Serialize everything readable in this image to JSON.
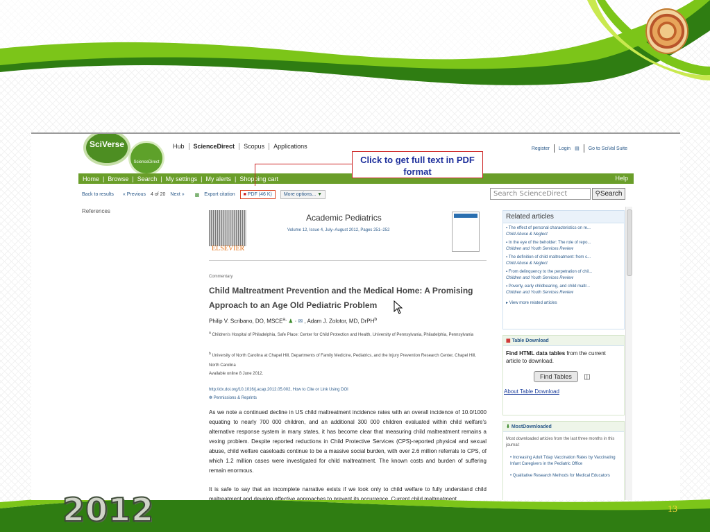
{
  "slide": {
    "page_number": "13",
    "year": "2012"
  },
  "colors": {
    "slide_green": "#7cc519",
    "slide_dark_green": "#2f7d12",
    "brand_green": "#6a9e2a",
    "callout_red": "#cc2222",
    "link_blue": "#2b5a8a"
  },
  "browser": {
    "logo_main": "SciVerse",
    "logo_sub": "ScienceDirect",
    "topnav": [
      "Hub",
      "ScienceDirect",
      "Scopus",
      "Applications"
    ],
    "topright": [
      "Register",
      "Login",
      "Go to SciVal Suite"
    ],
    "callout": "Click to get full text in PDF format",
    "greenbar": [
      "Home",
      "Browse",
      "Search",
      "My settings",
      "My alerts",
      "Shopping cart"
    ],
    "help": "Help",
    "toolrow": {
      "back": "Back to results",
      "previous": "« Previous",
      "position": "4 of 20",
      "next": "Next »",
      "export": "Export citation",
      "pdf": "PDF (46 K)",
      "more": "More options..."
    },
    "search": {
      "placeholder": "Search ScienceDirect",
      "button": "Search"
    },
    "left_label": "References",
    "article": {
      "publisher": "ELSEVIER",
      "journal": "Academic Pediatrics",
      "volume": "Volume 12, Issue 4, July–August 2012, Pages 251–252",
      "type": "Commentary",
      "title": "Child Maltreatment Prevention and the Medical Home: A Promising Approach to an Age Old Pediatric Problem",
      "authors": "Philip V. Scribano, DO, MSCE",
      "authors_2": ", Adam J. Zolotor, MD, DrPH",
      "affil_a": "Children's Hospital of Philadelphia, Safe Place: Center for Child Protection and Health, University of Pennsylvania, Philadelphia, Pennsylvania",
      "affil_b": "University of North Carolina at Chapel Hill, Departments of Family Medicine, Pediatrics, and the Injury Prevention Research Center, Chapel Hill, North Carolina",
      "available": "Available online 8 June 2012.",
      "doi": "http://dx.doi.org/10.1016/j.acap.2012.05.002, How to Cite or Link Using DOI",
      "permissions": "Permissions & Reprints",
      "para1": "As we note a continued decline in US child maltreatment incidence rates with an overall incidence of 10.0/1000 equating to nearly 700 000 children, and an additional 300 000 children evaluated within child welfare's alternative response system in many states, it has become clear that measuring child maltreatment remains a vexing problem. Despite reported reductions in Child Protective Services (CPS)-reported physical and sexual abuse, child welfare caseloads continue to be a massive social burden, with over 2.6 million referrals to CPS, of which 1.2 million cases were investigated for child maltreatment. The known costs and burden of suffering remain enormous.",
      "para2": "It is safe to say that an incomplete narrative exists if we look only to child welfare to fully understand child maltreatment and develop effective approaches to prevent its occurrence. Current child maltreatment"
    },
    "related": {
      "title": "Related articles",
      "items": [
        {
          "t": "The effect of personal characteristics on re...",
          "j": "Child Abuse & Neglect"
        },
        {
          "t": "In the eye of the beholder: The role of repo...",
          "j": "Children and Youth Services Review"
        },
        {
          "t": "The definition of child maltreatment: from c...",
          "j": "Child Abuse & Neglect"
        },
        {
          "t": "From delinquency to the perpetration of chil...",
          "j": "Children and Youth Services Review"
        },
        {
          "t": "Poverty, early childbearing, and child maltr...",
          "j": "Children and Youth Services Review"
        }
      ],
      "more": "View more related articles"
    },
    "table_download": {
      "title": "Table Download",
      "body_bold": "Find HTML data tables",
      "body": " from the current article to download.",
      "button": "Find Tables",
      "link": "About Table Download"
    },
    "most": {
      "title": "MostDownloaded",
      "intro": "Most downloaded articles from the last three months in this journal:",
      "items": [
        "Increasing Adult Tdap Vaccination Rates by Vaccinating Infant Caregivers in the Pediatric Office",
        "Qualitative Research Methods for Medical Educators"
      ]
    }
  }
}
